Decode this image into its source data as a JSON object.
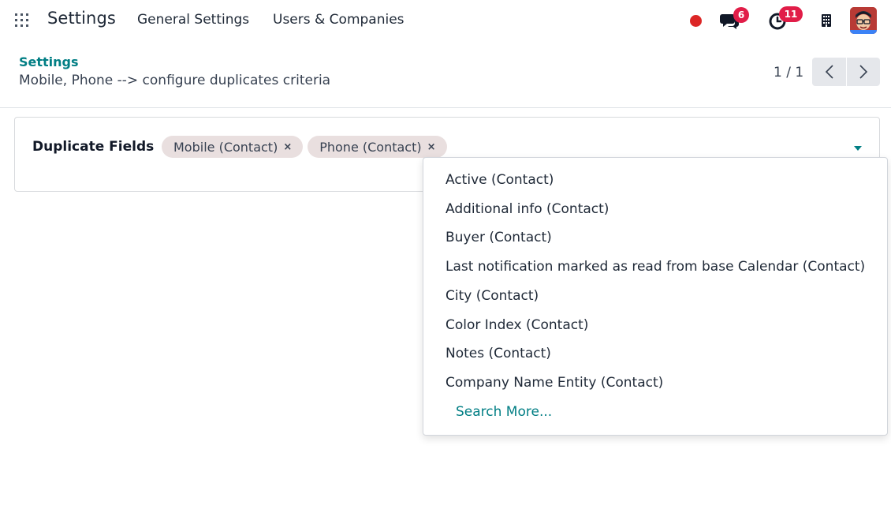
{
  "navbar": {
    "brand": "Settings",
    "menu": [
      "General Settings",
      "Users & Companies"
    ],
    "chat_count": "6",
    "activity_count": "11",
    "colors": {
      "record": "#dc2626",
      "badge": "#e11d48",
      "accent": "#017e84"
    }
  },
  "breadcrumb": {
    "parent": "Settings",
    "current": "Mobile, Phone --> configure duplicates criteria"
  },
  "pager": {
    "value": "1 / 1"
  },
  "form": {
    "field_label": "Duplicate Fields",
    "tags": [
      "Mobile (Contact)",
      "Phone (Contact)"
    ],
    "tag_remove": "×"
  },
  "dropdown": {
    "options": [
      "Active (Contact)",
      "Additional info (Contact)",
      "Buyer (Contact)",
      "Last notification marked as read from base Calendar (Contact)",
      "City (Contact)",
      "Color Index (Contact)",
      "Notes (Contact)",
      "Company Name Entity (Contact)"
    ],
    "search_more": "Search More..."
  }
}
